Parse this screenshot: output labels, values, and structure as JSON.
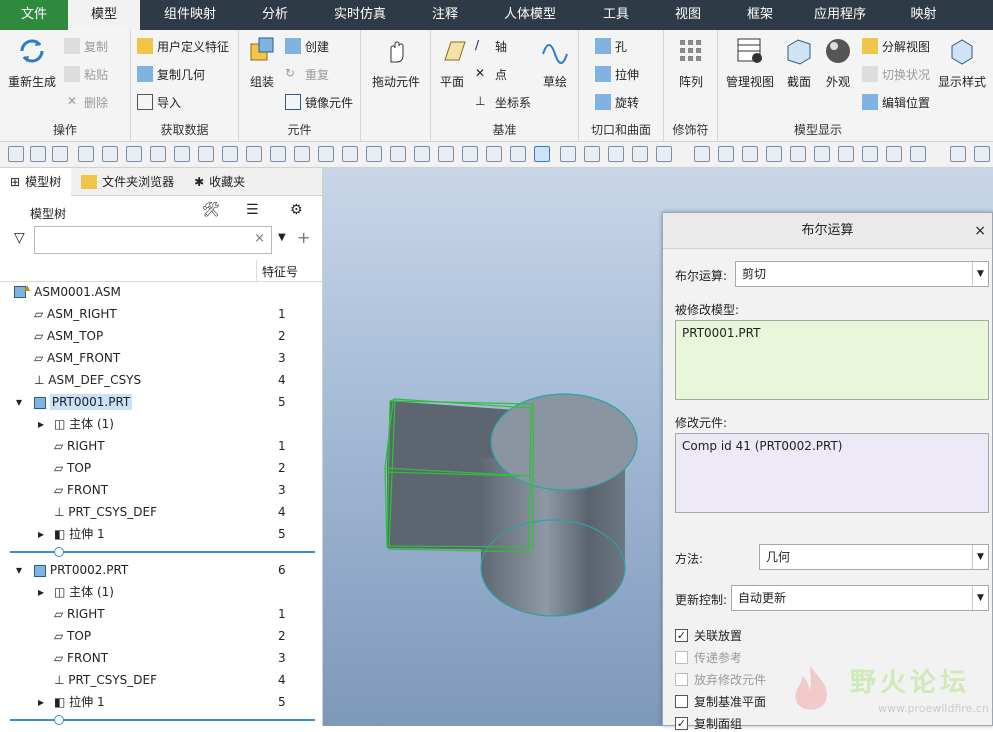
{
  "menu": {
    "file": "文件",
    "model": "模型",
    "comp_map": "组件映射",
    "analysis": "分析",
    "realtime_sim": "实时仿真",
    "annotate": "注释",
    "human_model": "人体模型",
    "tools": "工具",
    "view": "视图",
    "frame": "框架",
    "apps": "应用程序",
    "mapping": "映射"
  },
  "ribbon": {
    "regenerate": "重新生成",
    "copy": "复制",
    "paste": "粘贴",
    "delete": "删除",
    "ops": "操作",
    "udf": "用户定义特征",
    "copy_geom": "复制几何",
    "import": "导入",
    "get_data": "获取数据",
    "assemble": "组装",
    "create": "创建",
    "repeat": "重复",
    "mirror_comp": "镜像元件",
    "component": "元件",
    "drag_comp": "拖动元件",
    "plane": "平面",
    "axis": "轴",
    "point": "点",
    "csys": "坐标系",
    "sketch": "草绘",
    "datum": "基准",
    "hole": "孔",
    "extrude": "拉伸",
    "revolve": "旋转",
    "cut_surf": "切口和曲面",
    "array": "阵列",
    "modifier": "修饰符",
    "manage_views": "管理视图",
    "section": "截面",
    "appearance": "外观",
    "explode_view": "分解视图",
    "toggle_state": "切换状况",
    "edit_position": "编辑位置",
    "model_display": "模型显示",
    "display_style": "显示样式"
  },
  "left": {
    "tab_model_tree": "模型树",
    "tab_folder": "文件夹浏览器",
    "tab_fav": "收藏夹",
    "tree_title": "模型树",
    "filter_clear": "×",
    "col_feature_id": "特征号",
    "rows": [
      {
        "label": "ASM0001.ASM",
        "num": ""
      },
      {
        "label": "ASM_RIGHT",
        "num": "1"
      },
      {
        "label": "ASM_TOP",
        "num": "2"
      },
      {
        "label": "ASM_FRONT",
        "num": "3"
      },
      {
        "label": "ASM_DEF_CSYS",
        "num": "4"
      },
      {
        "label": "PRT0001.PRT",
        "num": "5"
      },
      {
        "label": "主体 (1)",
        "num": ""
      },
      {
        "label": "RIGHT",
        "num": "1"
      },
      {
        "label": "TOP",
        "num": "2"
      },
      {
        "label": "FRONT",
        "num": "3"
      },
      {
        "label": "PRT_CSYS_DEF",
        "num": "4"
      },
      {
        "label": "拉伸 1",
        "num": "5"
      },
      {
        "label": "PRT0002.PRT",
        "num": "6"
      },
      {
        "label": "主体 (1)",
        "num": ""
      },
      {
        "label": "RIGHT",
        "num": "1"
      },
      {
        "label": "TOP",
        "num": "2"
      },
      {
        "label": "FRONT",
        "num": "3"
      },
      {
        "label": "PRT_CSYS_DEF",
        "num": "4"
      },
      {
        "label": "拉伸 1",
        "num": "5"
      }
    ]
  },
  "dialog": {
    "title": "布尔运算",
    "close": "×",
    "op_label": "布尔运算:",
    "op_value": "剪切",
    "modified_label": "被修改模型:",
    "modified_value": "PRT0001.PRT",
    "modifying_label": "修改元件:",
    "modifying_value": "Comp id 41 (PRT0002.PRT)",
    "method_label": "方法:",
    "method_value": "几何",
    "update_label": "更新控制:",
    "update_value": "自动更新",
    "cb_assoc": "关联放置",
    "cb_pass_ref": "传递参考",
    "cb_discard": "放弃修改元件",
    "cb_copy_datum": "复制基准平面",
    "cb_copy_facet": "复制面组"
  },
  "watermark": {
    "text": "野火论坛",
    "url": "www.proewildfire.cn"
  },
  "colors": {
    "menubar": "#2e3b47",
    "file_tab": "#2f8a3d",
    "modified_bg": "#e9f6d9",
    "modifying_bg": "#eee9f7",
    "selection": "#c9e2f7"
  }
}
